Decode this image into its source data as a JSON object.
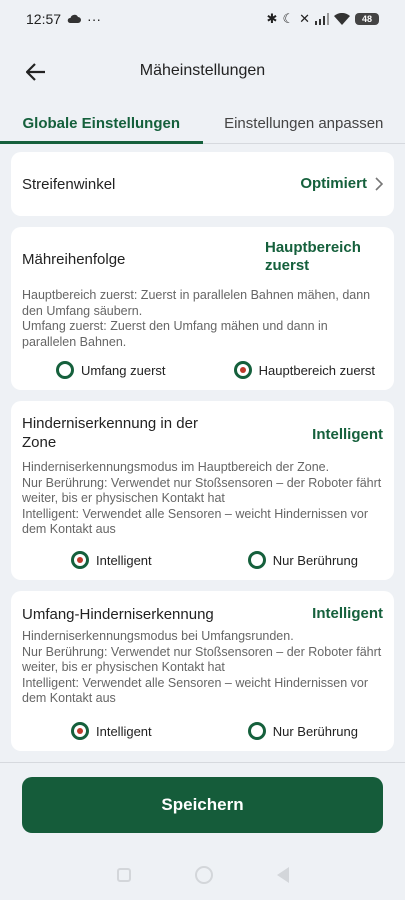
{
  "status": {
    "time": "12:57",
    "dots": "···",
    "battery": "48"
  },
  "header": {
    "title": "Mäheinstellungen"
  },
  "tabs": [
    {
      "label": "Globale Einstellungen",
      "active": true
    },
    {
      "label": "Einstellungen anpassen",
      "active": false
    }
  ],
  "stripe": {
    "label": "Streifenwinkel",
    "value": "Optimiert"
  },
  "mow_order": {
    "title": "Mähreihenfolge",
    "value": "Hauptbereich zuerst",
    "desc_1": "Hauptbereich zuerst: Zuerst in parallelen Bahnen mähen, dann den Umfang säubern.",
    "desc_2": "Umfang zuerst: Zuerst den Umfang mähen und dann in parallelen Bahnen.",
    "options": [
      {
        "label": "Umfang zuerst",
        "selected": false
      },
      {
        "label": "Hauptbereich zuerst",
        "selected": true
      }
    ]
  },
  "zone_obstacle": {
    "title": "Hinderniserkennung in der Zone",
    "value": "Intelligent",
    "desc_1": "Hinderniserkennungsmodus im Hauptbereich der Zone.",
    "desc_2": "Nur Berührung: Verwendet nur Stoßsensoren – der Roboter fährt weiter, bis er physischen Kontakt hat",
    "desc_3": "Intelligent: Verwendet alle Sensoren – weicht Hindernissen vor dem Kontakt aus",
    "options": [
      {
        "label": "Intelligent",
        "selected": true
      },
      {
        "label": "Nur Berührung",
        "selected": false
      }
    ]
  },
  "perimeter_obstacle": {
    "title": "Umfang-Hinderniserkennung",
    "value": "Intelligent",
    "desc_1": "Hinderniserkennungsmodus bei Umfangsrunden.",
    "desc_2": "Nur Berührung: Verwendet nur Stoßsensoren – der Roboter fährt weiter, bis er physischen Kontakt hat",
    "desc_3": "Intelligent: Verwendet alle Sensoren – weicht Hindernissen vor dem Kontakt aus",
    "options": [
      {
        "label": "Intelligent",
        "selected": true
      },
      {
        "label": "Nur Berührung",
        "selected": false
      }
    ]
  },
  "save_label": "Speichern",
  "colors": {
    "accent": "#15603c",
    "background": "#eef1f5",
    "radio_dot": "#c0392b"
  }
}
